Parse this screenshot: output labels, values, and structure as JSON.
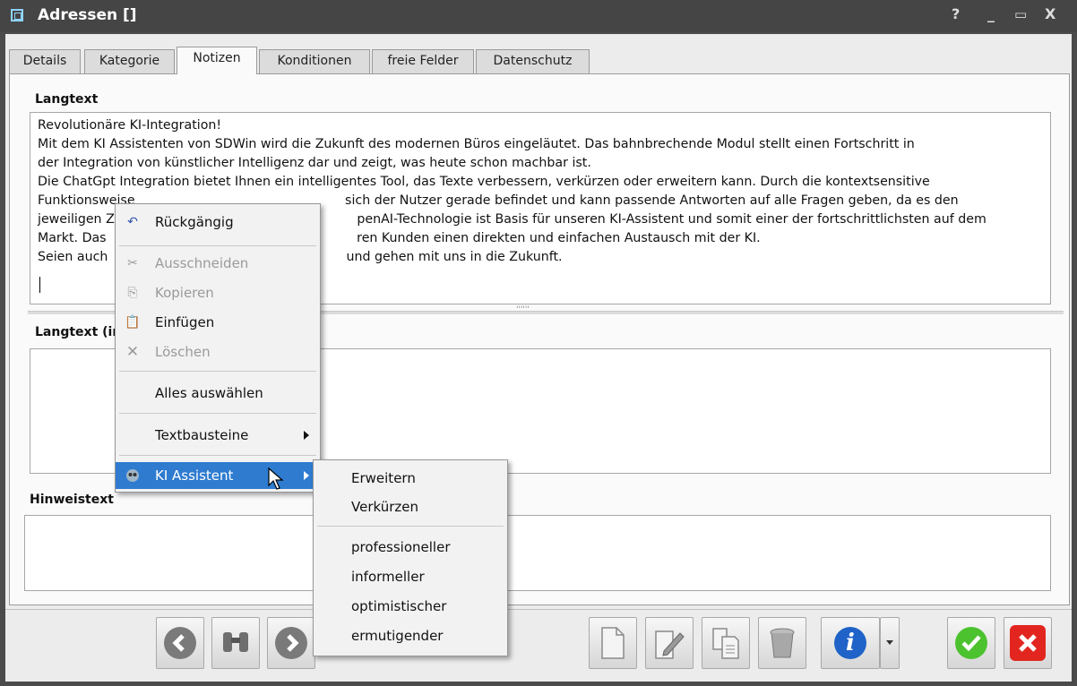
{
  "window": {
    "title": "Adressen []",
    "help_glyph": "?",
    "min_glyph": "_",
    "max_glyph": "▭",
    "close_glyph": "X"
  },
  "tabs": [
    {
      "label": "Details"
    },
    {
      "label": "Kategorie"
    },
    {
      "label": "Notizen"
    },
    {
      "label": "Konditionen"
    },
    {
      "label": "freie Felder"
    },
    {
      "label": "Datenschutz"
    }
  ],
  "active_tab": "Notizen",
  "fields": {
    "langtext_label": "Langtext",
    "langtext_value": "Revolutionäre KI-Integration!\nMit dem KI Assistenten von SDWin wird die Zukunft des modernen Büros eingeläutet. Das bahnbrechende Modul stellt einen Fortschritt in\nder Integration von künstlicher Intelligenz dar und zeigt, was heute schon machbar ist.\nDie ChatGpt Integration bietet Ihnen ein intelligentes Tool, das Texte verbessern, verkürzen oder erweitern kann. Durch die kontextsensitive\nFunktionsweise                                                    sich der Nutzer gerade befindet und kann passende Antworten auf alle Fragen geben, da es den\njeweiligen Z                                                            penAI-Technologie ist Basis für unseren KI-Assistent und somit einer der fortschrittlichsten auf dem\nMarkt. Das                                                              ren Kunden einen direkten und einfachen Austausch mit der KI.\nSeien auch                                                           und gehen mit uns in die Zukunft.",
    "langtext2_label": "Langtext (in",
    "hinweistext_label": "Hinweistext"
  },
  "context_menu": {
    "items": [
      {
        "label": "Rückgängig",
        "icon": "undo-icon",
        "enabled": true
      },
      {
        "label": "Ausschneiden",
        "icon": "scissors-icon",
        "enabled": false
      },
      {
        "label": "Kopieren",
        "icon": "copy-icon",
        "enabled": false
      },
      {
        "label": "Einfügen",
        "icon": "paste-icon",
        "enabled": true
      },
      {
        "label": "Löschen",
        "icon": "delete-x-icon",
        "enabled": false
      },
      {
        "label": "Alles auswählen",
        "enabled": true
      },
      {
        "label": "Textbausteine",
        "enabled": true
      },
      {
        "label": "KI Assistent",
        "icon": "robot-icon",
        "enabled": true
      }
    ]
  },
  "submenu": {
    "items": [
      {
        "label": "Erweitern"
      },
      {
        "label": "Verkürzen"
      },
      {
        "label": "professioneller"
      },
      {
        "label": "informeller"
      },
      {
        "label": "optimistischer"
      },
      {
        "label": "ermutigender"
      }
    ]
  },
  "toolbar": {
    "icons": [
      "back-arrow-icon",
      "binoculars-icon",
      "forward-arrow-icon",
      "new-document-icon",
      "edit-pencil-icon",
      "copy-document-icon",
      "trash-icon",
      "info-icon",
      "dropdown-icon",
      "ok-check-icon",
      "cancel-x-icon"
    ]
  },
  "colors": {
    "highlight": "#2e7bd0",
    "ok": "#4cc22f",
    "cancel": "#e2261f",
    "info": "#1f63c8"
  }
}
